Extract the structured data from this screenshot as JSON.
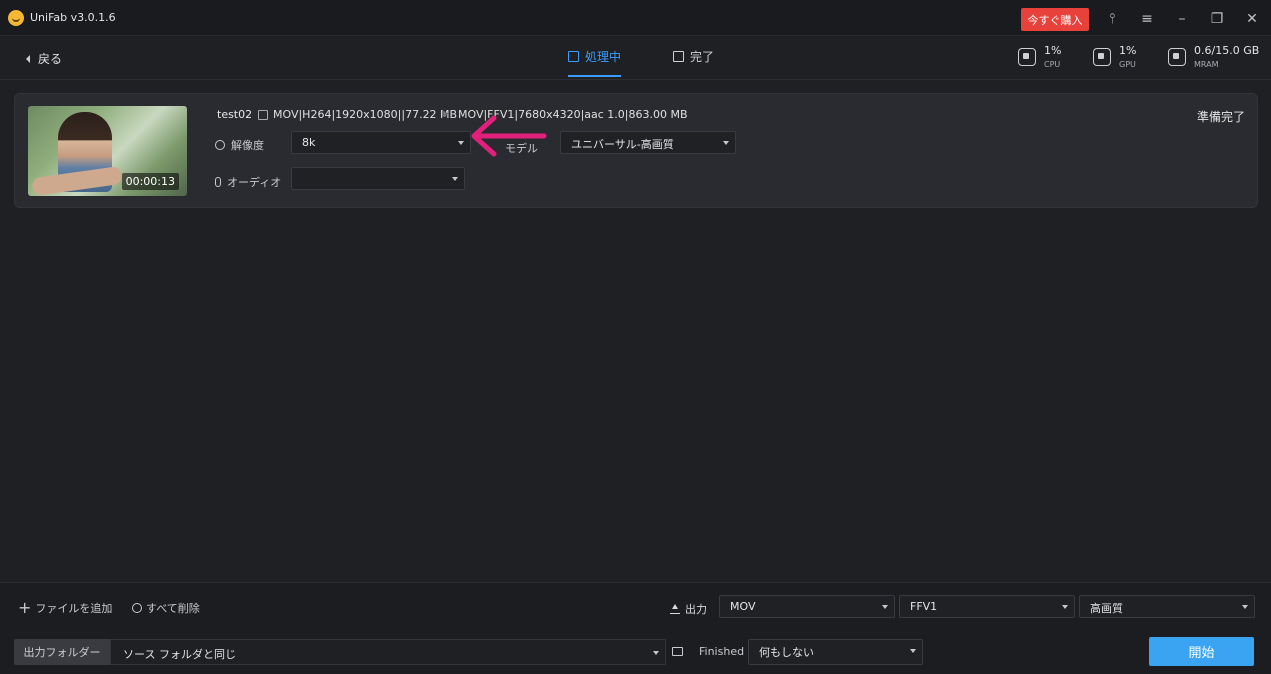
{
  "app": {
    "title": "UniFab v3.0.1.6",
    "buy_label": "今すぐ購入",
    "window_icons": [
      "shirt-icon",
      "menu-icon",
      "minimize-icon",
      "restore-icon",
      "close-icon"
    ]
  },
  "nav": {
    "back_label": "戻る",
    "tabs": [
      {
        "label": "処理中",
        "active": true
      },
      {
        "label": "完了",
        "active": false
      }
    ],
    "stats": [
      {
        "value": "1%",
        "label": "CPU"
      },
      {
        "value": "1%",
        "label": "GPU"
      },
      {
        "value": "0.6/15.0 GB",
        "label": "MRAM"
      }
    ]
  },
  "task": {
    "filename": "test02",
    "duration": "00:00:13",
    "source_info": "MOV|H264|1920x1080||77.22 MB",
    "output_info": "MOV|FFV1|7680x4320|aac 1.0|863.00 MB",
    "status": "準備完了",
    "resolution_label": "解像度",
    "resolution_value": "8k",
    "model_label": "モデル",
    "model_value": "ユニバーサル-高画質",
    "audio_label": "オーディオ",
    "audio_value": ""
  },
  "bottom": {
    "add_file_label": "ファイルを追加",
    "delete_all_label": "すべて削除",
    "output_label": "出力",
    "output_format": "MOV",
    "output_codec": "FFV1",
    "output_quality": "高画質",
    "folder_label": "出力フォルダー",
    "folder_value": "ソース フォルダと同じ",
    "finished_label": "Finished",
    "finished_value": "何もしない",
    "start_label": "開始"
  },
  "colors": {
    "accent": "#3a9cff",
    "buy": "#e8413b",
    "start": "#3aa3f2",
    "annotation": "#e0207a"
  }
}
